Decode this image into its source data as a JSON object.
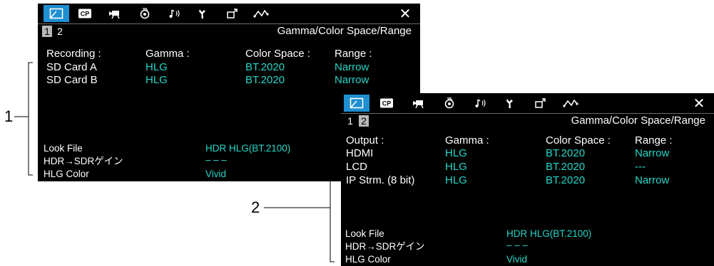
{
  "panel1": {
    "title": "Gamma/Color Space/Range",
    "pages": [
      "1",
      "2"
    ],
    "active_page": "1",
    "headers": [
      "Recording :",
      "Gamma :",
      "Color Space :",
      "Range :"
    ],
    "rows": [
      {
        "label": "SD Card A",
        "gamma": "HLG",
        "colorspace": "BT.2020",
        "range": "Narrow"
      },
      {
        "label": "SD Card B",
        "gamma": "HLG",
        "colorspace": "BT.2020",
        "range": "Narrow"
      }
    ],
    "settings": [
      {
        "label": "Look File",
        "value": "HDR HLG(BT.2100)"
      },
      {
        "label": "HDR→SDRゲイン",
        "value": "– – –"
      },
      {
        "label": "HLG Color",
        "value": "Vivid"
      }
    ]
  },
  "panel2": {
    "title": "Gamma/Color Space/Range",
    "pages": [
      "1",
      "2"
    ],
    "active_page": "2",
    "headers": [
      "Output :",
      "Gamma :",
      "Color Space :",
      "Range :"
    ],
    "rows": [
      {
        "label": "HDMI",
        "gamma": "HLG",
        "colorspace": "BT.2020",
        "range": "Narrow"
      },
      {
        "label": "LCD",
        "gamma": "HLG",
        "colorspace": "BT.2020",
        "range": "---"
      },
      {
        "label": "IP Strm. (8 bit)",
        "gamma": "HLG",
        "colorspace": "BT.2020",
        "range": "Narrow"
      }
    ],
    "settings": [
      {
        "label": "Look File",
        "value": "HDR HLG(BT.2100)"
      },
      {
        "label": "HDR→SDRゲイン",
        "value": "– – –"
      },
      {
        "label": "HLG Color",
        "value": "Vivid"
      }
    ]
  },
  "tabs": [
    {
      "icon": "camera-settings-icon",
      "text": ""
    },
    {
      "icon": "custom-picture-icon",
      "text": "CP"
    },
    {
      "icon": "recording-setup-icon",
      "text": ""
    },
    {
      "icon": "assistance-functions-icon",
      "text": ""
    },
    {
      "icon": "audio-setup-icon",
      "text": ""
    },
    {
      "icon": "system-setup-icon",
      "text": ""
    },
    {
      "icon": "my-menu-icon",
      "text": ""
    },
    {
      "icon": "network-icon",
      "text": ""
    }
  ],
  "close_icon": "close-icon",
  "callouts": [
    "1",
    "2"
  ],
  "colors": {
    "accent": "#1e8fd0",
    "value": "#26d6c8",
    "background": "#000000"
  }
}
